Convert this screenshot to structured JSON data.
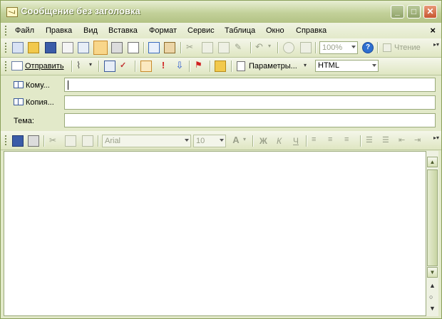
{
  "window": {
    "title": "Сообщение без заголовка"
  },
  "menu": {
    "items": [
      {
        "label": "Файл"
      },
      {
        "label": "Правка"
      },
      {
        "label": "Вид"
      },
      {
        "label": "Вставка"
      },
      {
        "label": "Формат"
      },
      {
        "label": "Сервис"
      },
      {
        "label": "Таблица"
      },
      {
        "label": "Окно"
      },
      {
        "label": "Справка"
      }
    ],
    "close_glyph": "×"
  },
  "toolbar_standard": {
    "zoom_value": "100%",
    "reading_label": "Чтение"
  },
  "toolbar_email": {
    "send_label": "Отправить",
    "options_label": "Параметры...",
    "format_value": "HTML"
  },
  "fields": {
    "to_label": "Кому...",
    "cc_label": "Копия...",
    "subject_label": "Тема:",
    "to_value": "",
    "cc_value": "",
    "subject_value": ""
  },
  "toolbar_format": {
    "font_value": "Arial",
    "size_value": "10",
    "bold_label": "Ж",
    "italic_label": "К",
    "underline_label": "Ч"
  },
  "colors": {
    "chrome": "#e2e9c9",
    "close_button": "#c8562f",
    "frame": "#8aa05a"
  }
}
